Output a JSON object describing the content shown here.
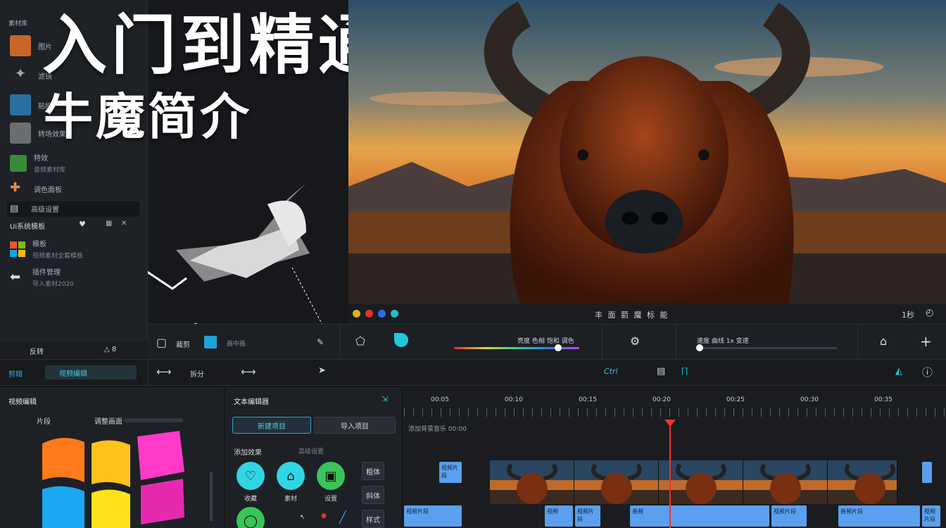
{
  "overlay": {
    "title": "入门到精通",
    "subtitle": "牛魔简介"
  },
  "asset_panel": {
    "tab": "素材库",
    "items": [
      {
        "label": "图片",
        "sub": ""
      },
      {
        "label": "滤镜",
        "sub": ""
      },
      {
        "label": "贴纸",
        "sub": ""
      },
      {
        "label": "转场效果",
        "sub": ""
      },
      {
        "label": "特效",
        "sub": "音频素材库"
      },
      {
        "label": "调色面板",
        "sub": ""
      },
      {
        "label": "高级设置",
        "sub": ""
      }
    ],
    "section": "Ui系统模板",
    "section_items": [
      {
        "label": "模板",
        "sub": "视频素材全套模板"
      },
      {
        "label": "插件管理",
        "sub": "导入素材2020"
      }
    ],
    "footer_left": "反转",
    "footer_right": "△ 8"
  },
  "preview": {
    "colors": [
      "#e0b020",
      "#e03030",
      "#2a6ef0",
      "#20c0c8"
    ],
    "controls_text": "丰 面 箭 魔 标 能",
    "right_text": "1秒"
  },
  "control_bar": {
    "left_label": "裁剪",
    "mid_label": "画中画",
    "color_label": "亮度 色相 饱和 调色",
    "speed_label": "速度 曲线 1x 变速",
    "color_value": 0.83,
    "speed_value": 0.02
  },
  "toolbar": {
    "left_tab": "剪辑",
    "active_tab": "视频编辑",
    "split": "拆分",
    "logo": "Ctrl"
  },
  "panel_a": {
    "title": "视频编辑",
    "label1": "片段",
    "label2": "调整画面"
  },
  "panel_b": {
    "title": "文本编辑器",
    "btn_active": "新建项目",
    "btn_other": "导入项目",
    "section": "添加效果",
    "section_right": "高级设置",
    "icons": [
      {
        "label": "收藏",
        "color": "#30d6e4"
      },
      {
        "label": "素材",
        "color": "#30d6e4"
      },
      {
        "label": "设置",
        "color": "#3ac45a"
      }
    ],
    "side_buttons": [
      "粗体",
      "斜体",
      "样式"
    ]
  },
  "timeline": {
    "ruler": [
      "00:05",
      "00:10",
      "00:15",
      "00:20",
      "00:25",
      "00:30",
      "00:35"
    ],
    "track_label": "添加背景音乐 00:00",
    "clips": [
      "视频片段",
      "视频片段",
      "视频",
      "视频片段",
      "音频",
      "视频片段",
      "音频片段",
      "视频片段"
    ]
  }
}
